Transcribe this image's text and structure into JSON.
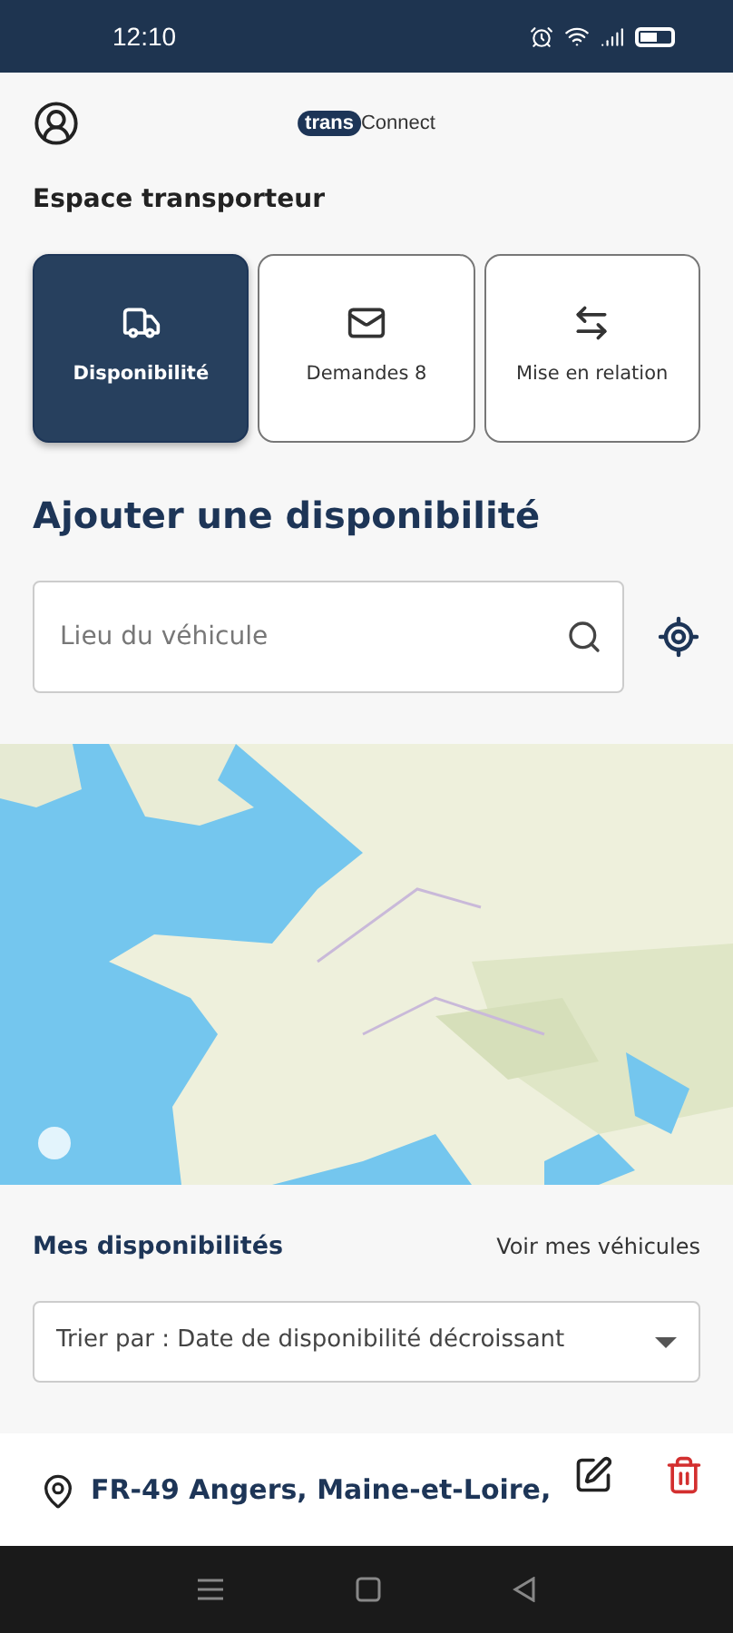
{
  "status_bar": {
    "time": "12:10"
  },
  "header": {
    "logo": {
      "left": "trans",
      "right": "Connect"
    }
  },
  "section_title": "Espace transporteur",
  "tabs": [
    {
      "label": "Disponibilité",
      "selected": true
    },
    {
      "label": "Demandes 8",
      "selected": false
    },
    {
      "label": "Mise en relation",
      "selected": false
    }
  ],
  "form": {
    "title": "Ajouter une disponibilité",
    "search": {
      "placeholder": "Lieu du véhicule"
    }
  },
  "list": {
    "title": "Mes disponibilités",
    "link": "Voir mes véhicules",
    "sort": "Trier par : Date de disponibilité décroissant",
    "items": [
      {
        "location": "FR-49 Angers, Maine-et-Loire,"
      }
    ]
  }
}
